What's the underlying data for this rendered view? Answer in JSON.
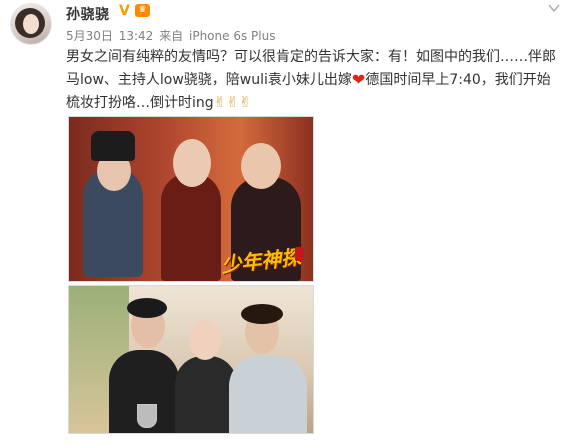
{
  "post": {
    "username": "孙骁骁",
    "verified_icon": "verified-v-icon",
    "vip_icon": "vip-crown-icon",
    "date": "5月30日",
    "time": "13:42",
    "source_prefix": "来自",
    "source": "iPhone 6s Plus",
    "text_part1": "男女之间有纯粹的友情吗？可以很肯定的告诉大家：有！如图中的我们……伴郎马low、主持人low骁骁，陪wuli袁小妹儿出嫁",
    "text_part2": "德国时间早上7:40，我们开始梳妆打扮咯…倒计时ing",
    "emoji_heart": "❤",
    "emoji_victory": "✌",
    "accent_color": "#f6a000"
  },
  "images": {
    "first_caption": "少年神探"
  }
}
